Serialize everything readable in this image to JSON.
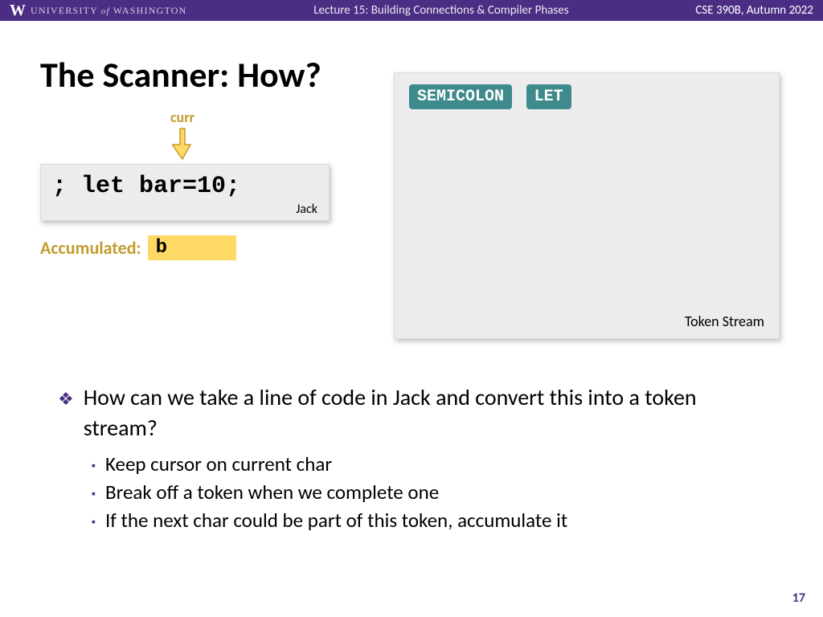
{
  "header": {
    "university_pre": "UNIVERSITY",
    "university_of": "of",
    "university_post": "WASHINGTON",
    "lecture": "Lecture 15: Building Connections & Compiler Phases",
    "course": "CSE 390B, Autumn 2022"
  },
  "title": "The Scanner: How?",
  "curr_label": "curr",
  "code": {
    "text": "; let bar=10;",
    "lang": "Jack"
  },
  "accumulated": {
    "label": "Accumulated:",
    "value": "b"
  },
  "tokens": [
    "SEMICOLON",
    "LET"
  ],
  "token_stream_label": "Token Stream",
  "bullet_main": "How can we take a line of code in Jack and convert this into a token stream?",
  "sub_bullets": [
    "Keep cursor on current char",
    "Break off a token when we complete one",
    "If the next char could be part of this token, accumulate it"
  ],
  "page_number": "17"
}
